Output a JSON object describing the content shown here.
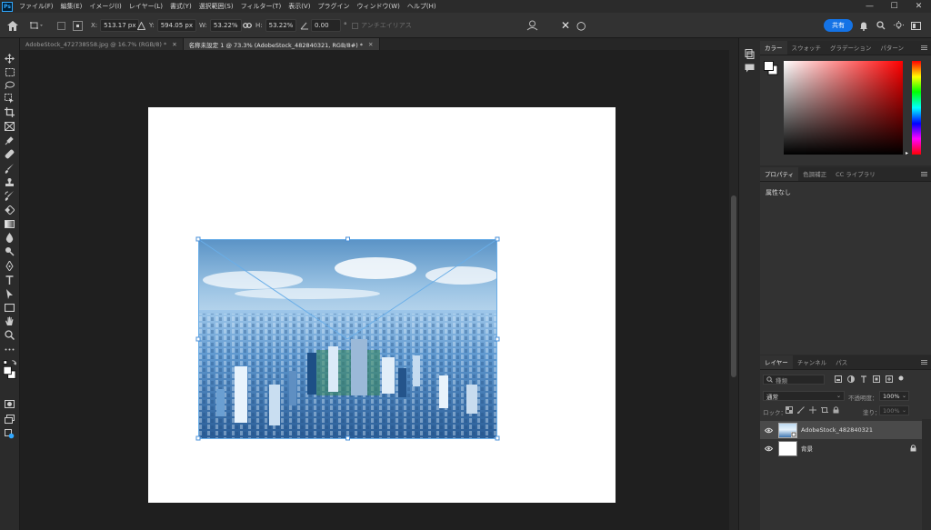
{
  "app": {
    "logo": "Ps"
  },
  "menu": [
    "ファイル(F)",
    "編集(E)",
    "イメージ(I)",
    "レイヤー(L)",
    "書式(Y)",
    "選択範囲(S)",
    "フィルター(T)",
    "表示(V)",
    "プラグイン",
    "ウィンドウ(W)",
    "ヘルプ(H)"
  ],
  "window_controls": {
    "minimize": "—",
    "maximize": "☐",
    "close": "✕"
  },
  "options": {
    "x_label": "X:",
    "x_value": "513.17 px",
    "y_label": "Y:",
    "y_value": "594.05 px",
    "w_label": "W:",
    "w_value": "53.22%",
    "h_label": "H:",
    "h_value": "53.22%",
    "angle_value": "0.00",
    "angle_unit": "°",
    "antialias_label": "アンチエイリアス",
    "cancel": "✕",
    "commit": "○",
    "share": "共有"
  },
  "tabs": [
    {
      "label": "AdobeStock_472738558.jpg @ 16.7% (RGB/8) *",
      "active": false
    },
    {
      "label": "名称未設定 1 @ 73.3% (AdobeStock_482840321, RGB/8#) *",
      "active": true
    }
  ],
  "color_panel": {
    "tabs": [
      "カラー",
      "スウォッチ",
      "グラデーション",
      "パターン"
    ]
  },
  "properties_panel": {
    "tabs": [
      "プロパティ",
      "色調補正",
      "CC ライブラリ"
    ],
    "empty_text": "属性なし"
  },
  "layers_panel": {
    "tabs": [
      "レイヤー",
      "チャンネル",
      "パス"
    ],
    "filter_placeholder": "種類",
    "blend_mode": "通常",
    "opacity_label": "不透明度：",
    "opacity_value": "100%",
    "lock_label": "ロック：",
    "fill_label": "塗り：",
    "fill_value": "100%",
    "layers": [
      {
        "name": "AdobeStock_482840321",
        "visible": true,
        "selected": true
      },
      {
        "name": "背景",
        "visible": true,
        "locked": true
      }
    ]
  },
  "colors": {
    "accent": "#1473e6",
    "panel": "#323232",
    "canvas_bg": "#1f1f1f",
    "sky": "#cfe6f5",
    "city": "#2f6aa8"
  }
}
